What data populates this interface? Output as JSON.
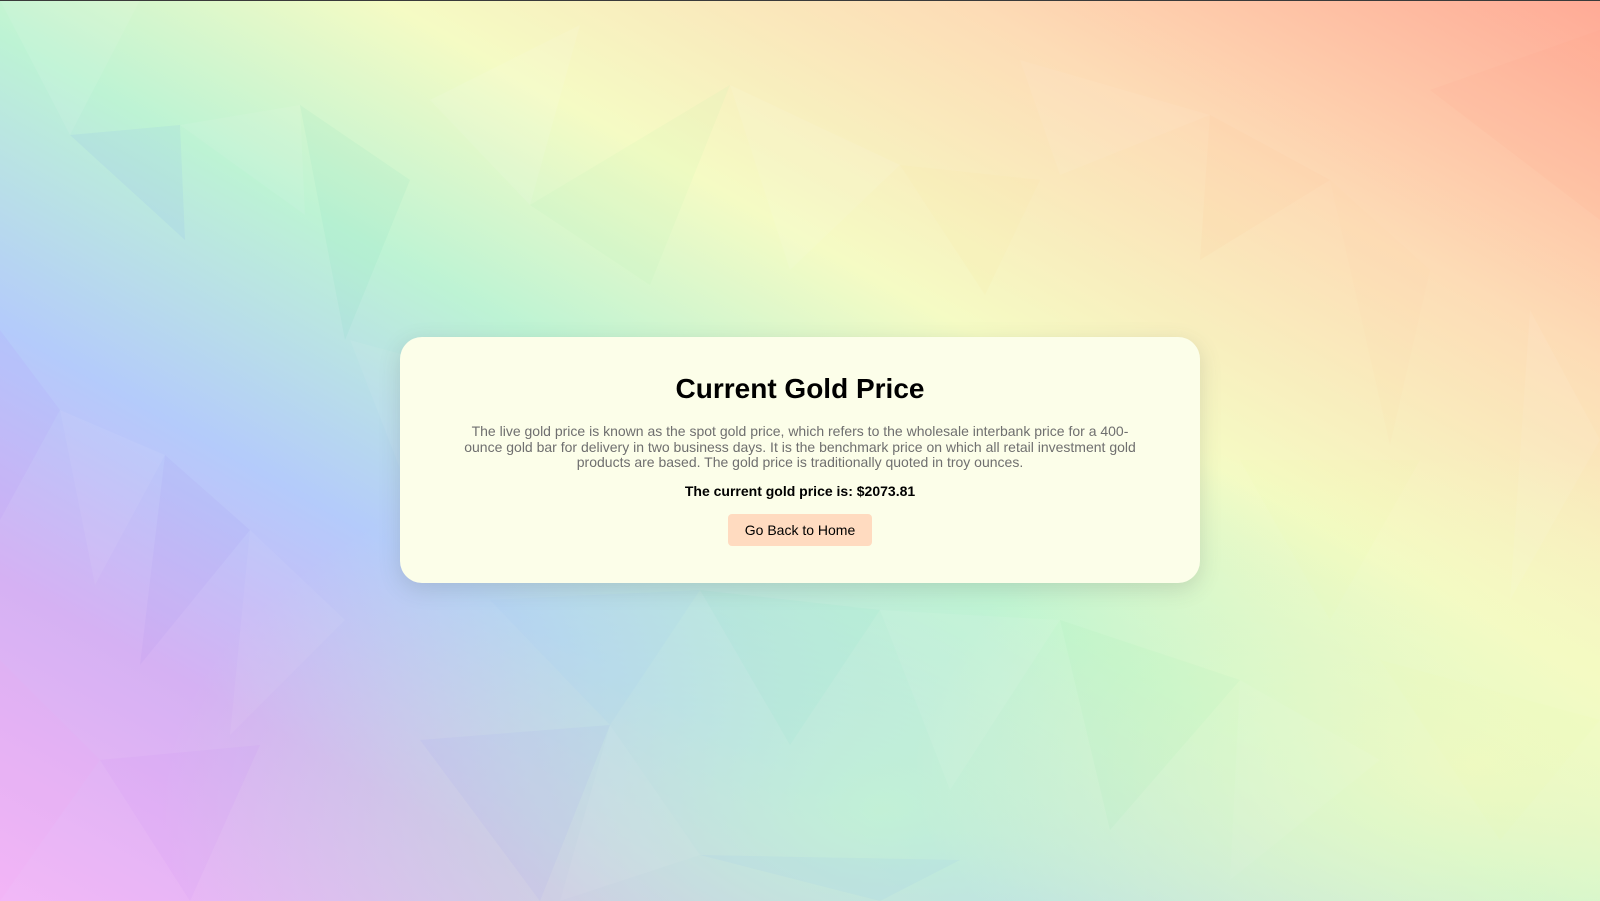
{
  "page": {
    "title": "Current Gold Price",
    "description": "The live gold price is known as the spot gold price, which refers to the wholesale interbank price for a 400-ounce gold bar for delivery in two business days. It is the benchmark price on which all retail investment gold products are based. The gold price is traditionally quoted in troy ounces.",
    "price_label": "The current gold price is: $2073.81",
    "button_label": "Go Back to Home"
  },
  "colors": {
    "card_background": "#fcfee9",
    "button_background": "#ffdbc0",
    "title_text": "#000000",
    "description_text": "#6f6f6f",
    "background_palette": [
      "#b6c9ff",
      "#c4f5cd",
      "#f7fcc6",
      "#fde0b5",
      "#ffb7a4",
      "#e4b7f6"
    ]
  }
}
